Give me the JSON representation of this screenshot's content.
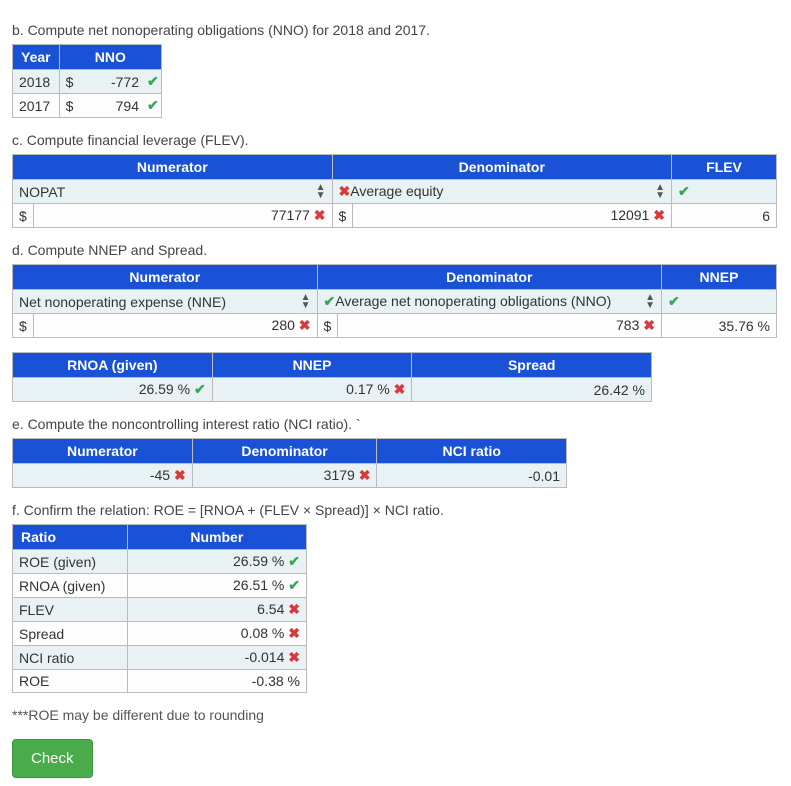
{
  "section_b": {
    "title": "b. Compute net nonoperating obligations (NNO) for 2018 and 2017.",
    "headers": {
      "year": "Year",
      "nno": "NNO"
    },
    "rows": [
      {
        "year": "2018",
        "currency": "$",
        "value": "-772",
        "mark": "check"
      },
      {
        "year": "2017",
        "currency": "$",
        "value": "794",
        "mark": "check"
      }
    ]
  },
  "section_c": {
    "title": "c. Compute financial leverage (FLEV).",
    "headers": {
      "numerator": "Numerator",
      "denominator": "Denominator",
      "result": "FLEV"
    },
    "row1": {
      "numerator_label": "NOPAT",
      "denominator_mark": "x",
      "denominator_label": "Average equity",
      "result_mark": "check"
    },
    "row2": {
      "numerator_currency": "$",
      "numerator_value": "77177",
      "numerator_mark": "x",
      "denominator_currency": "$",
      "denominator_value": "12091",
      "denominator_mark": "x",
      "result_value": "6"
    }
  },
  "section_d": {
    "title": "d. Compute NNEP and Spread.",
    "table1": {
      "headers": {
        "numerator": "Numerator",
        "denominator": "Denominator",
        "result": "NNEP"
      },
      "row1": {
        "numerator_label": "Net nonoperating expense (NNE)",
        "denominator_mark": "check",
        "denominator_label": "Average net nonoperating obligations (NNO)",
        "result_mark": "check"
      },
      "row2": {
        "numerator_currency": "$",
        "numerator_value": "280",
        "numerator_mark": "x",
        "denominator_currency": "$",
        "denominator_value": "783",
        "denominator_mark": "x",
        "result_value": "35.76 %"
      }
    },
    "table2": {
      "headers": {
        "rnoa": "RNOA (given)",
        "nnep": "NNEP",
        "spread": "Spread"
      },
      "row": {
        "rnoa_value": "26.59 %",
        "rnoa_mark": "check",
        "nnep_value": "0.17 %",
        "nnep_mark": "x",
        "spread_value": "26.42 %"
      }
    }
  },
  "section_e": {
    "title": "e. Compute the noncontrolling interest ratio (NCI ratio). `",
    "headers": {
      "numerator": "Numerator",
      "denominator": "Denominator",
      "result": "NCI ratio"
    },
    "row": {
      "numerator_value": "-45",
      "numerator_mark": "x",
      "denominator_value": "3179",
      "denominator_mark": "x",
      "result_value": "-0.01"
    }
  },
  "section_f": {
    "title": "f. Confirm the relation: ROE = [RNOA + (FLEV × Spread)] × NCI ratio.",
    "headers": {
      "ratio": "Ratio",
      "number": "Number"
    },
    "rows": [
      {
        "label": "ROE (given)",
        "value": "26.59 %",
        "mark": "check"
      },
      {
        "label": "RNOA (given)",
        "value": "26.51 %",
        "mark": "check"
      },
      {
        "label": "FLEV",
        "value": "6.54",
        "mark": "x"
      },
      {
        "label": "Spread",
        "value": "0.08 %",
        "mark": "x"
      },
      {
        "label": "NCI ratio",
        "value": "-0.014",
        "mark": "x"
      },
      {
        "label": "ROE",
        "value": "-0.38 %",
        "mark": ""
      }
    ]
  },
  "note": "***ROE may be different due to rounding",
  "button": {
    "check": "Check"
  }
}
